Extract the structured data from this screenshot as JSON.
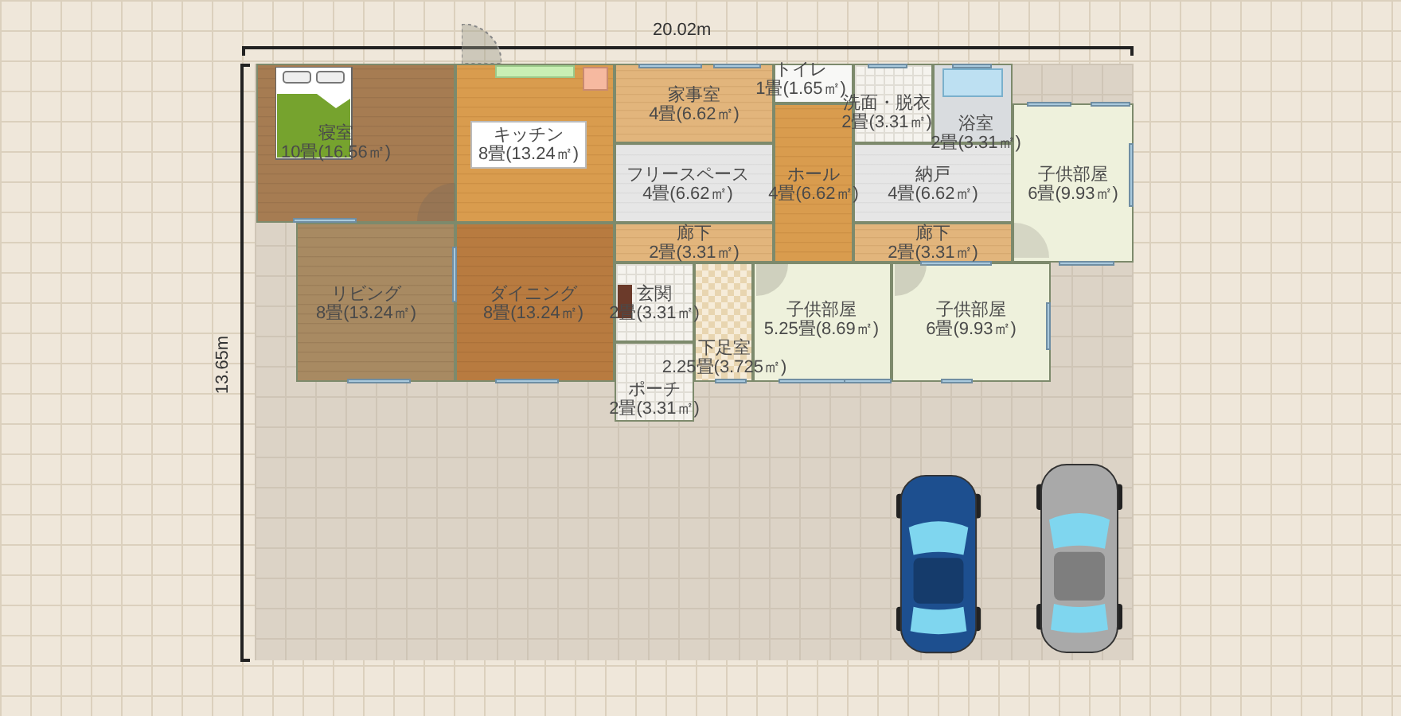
{
  "dimensions": {
    "width": "20.02m",
    "depth": "13.65m"
  },
  "rooms": [
    {
      "name": "寝室",
      "area": "10畳(16.56㎡)",
      "kind": "wood_dark"
    },
    {
      "name": "キッチン",
      "area": "8畳(13.24㎡)",
      "kind": "wood_light",
      "label_box": true
    },
    {
      "name": "家事室",
      "area": "4畳(6.62㎡)",
      "kind": "wood_pale"
    },
    {
      "name": "トイレ",
      "area": "1畳(1.65㎡)",
      "kind": "white"
    },
    {
      "name": "洗面・脱衣",
      "area": "2畳(3.31㎡)",
      "kind": "tile"
    },
    {
      "name": "浴室",
      "area": "2畳(3.31㎡)",
      "kind": "bath"
    },
    {
      "name": "フリースペース",
      "area": "4畳(6.62㎡)",
      "kind": "gray"
    },
    {
      "name": "ホール",
      "area": "4畳(6.62㎡)",
      "kind": "wood_light"
    },
    {
      "name": "納戸",
      "area": "4畳(6.62㎡)",
      "kind": "gray"
    },
    {
      "name": "子供部屋",
      "area": "6畳(9.93㎡)",
      "kind": "green"
    },
    {
      "name": "廊下",
      "area": "2畳(3.31㎡)",
      "kind": "wood_pale"
    },
    {
      "name": "廊下",
      "area": "2畳(3.31㎡)",
      "kind": "wood_pale"
    },
    {
      "name": "リビング",
      "area": "8畳(13.24㎡)",
      "kind": "wood_gray"
    },
    {
      "name": "ダイニング",
      "area": "8畳(13.24㎡)",
      "kind": "wood_red"
    },
    {
      "name": "玄関",
      "area": "2畳(3.31㎡)",
      "kind": "tile"
    },
    {
      "name": "下足室",
      "area": "2.25畳(3.725㎡)",
      "kind": "check"
    },
    {
      "name": "子供部屋",
      "area": "5.25畳(8.69㎡)",
      "kind": "green"
    },
    {
      "name": "子供部屋",
      "area": "6畳(9.93㎡)",
      "kind": "green"
    },
    {
      "name": "ポーチ",
      "area": "2畳(3.31㎡)",
      "kind": "tile"
    }
  ],
  "cars": [
    {
      "color": "#1d4f8f"
    },
    {
      "color": "#a9a9a9"
    }
  ]
}
